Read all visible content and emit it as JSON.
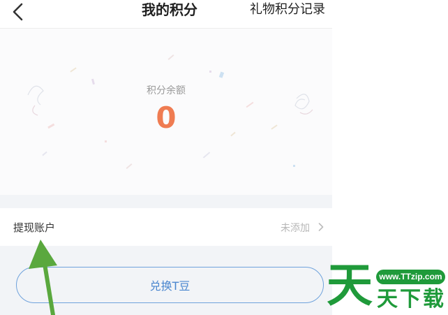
{
  "header": {
    "title": "我的积分",
    "right_link": "礼物积分记录"
  },
  "balance": {
    "label": "积分余额",
    "value": "0"
  },
  "account": {
    "label": "提现账户",
    "status": "未添加"
  },
  "exchange": {
    "label": "兑换T豆"
  },
  "watermark": {
    "url": "www.TTzip.com",
    "big_char": "天",
    "small_text": "天下载"
  },
  "colors": {
    "balance_value": "#ef7c52",
    "button_border": "#6fa2dc",
    "button_text": "#4a86cf",
    "annotation_arrow": "#5aa83e",
    "watermark_green": "#1f9a3a"
  },
  "icons": {
    "back": "chevron-left-icon",
    "row_chevron": "chevron-right-icon"
  }
}
